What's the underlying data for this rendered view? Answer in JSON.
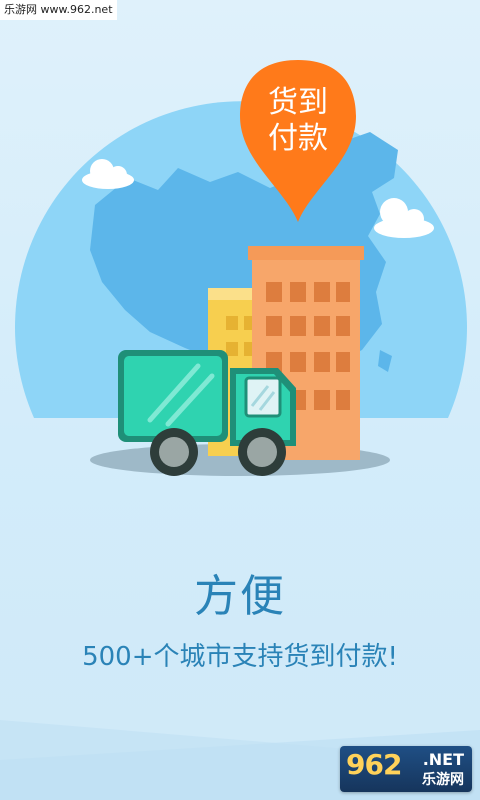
{
  "watermark": {
    "text": "乐游网 www.962.net"
  },
  "pin": {
    "line1": "货到",
    "line2": "付款"
  },
  "title": "方便",
  "subtitle": "500+个城市支持货到付款!",
  "logo": {
    "main": "962",
    "net": ".NET",
    "cn": "乐游网"
  },
  "colors": {
    "background": "#d3ecfa",
    "globe": "#7fcdf4",
    "map": "#56b4e8",
    "pin": "#ff7a1a",
    "truck": "#2fd3b0",
    "building": "#f7a66a",
    "text": "#2a83b7"
  }
}
